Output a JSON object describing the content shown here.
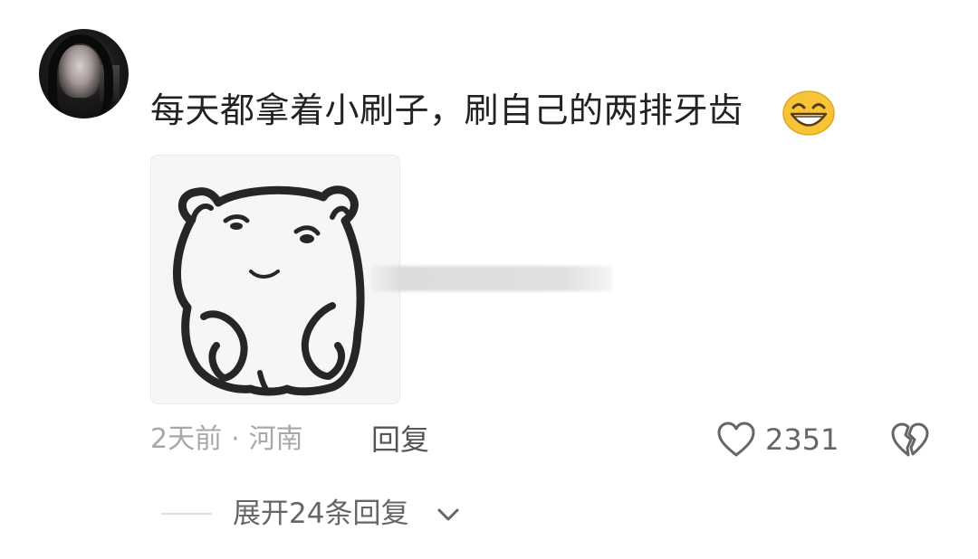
{
  "comment": {
    "avatar_icon": "user-avatar",
    "text": "每天都拿着小刷子，刷自己的两排牙齿",
    "emoji_icon": "grinning-face-emoji",
    "sticker_icon": "hamster-meme-sticker",
    "meta": {
      "time": "2天前",
      "separator": "·",
      "location": "河南"
    },
    "reply_label": "回复",
    "likes": "2351",
    "like_icon": "heart-outline-icon",
    "dislike_icon": "broken-heart-icon"
  },
  "replies": {
    "expand_label": "展开24条回复",
    "chevron_icon": "chevron-down-icon"
  },
  "colors": {
    "text_primary": "#222222",
    "meta_gray": "#a8a8a8",
    "icon_gray": "#666666",
    "emoji_yellow": "#f7c339"
  }
}
